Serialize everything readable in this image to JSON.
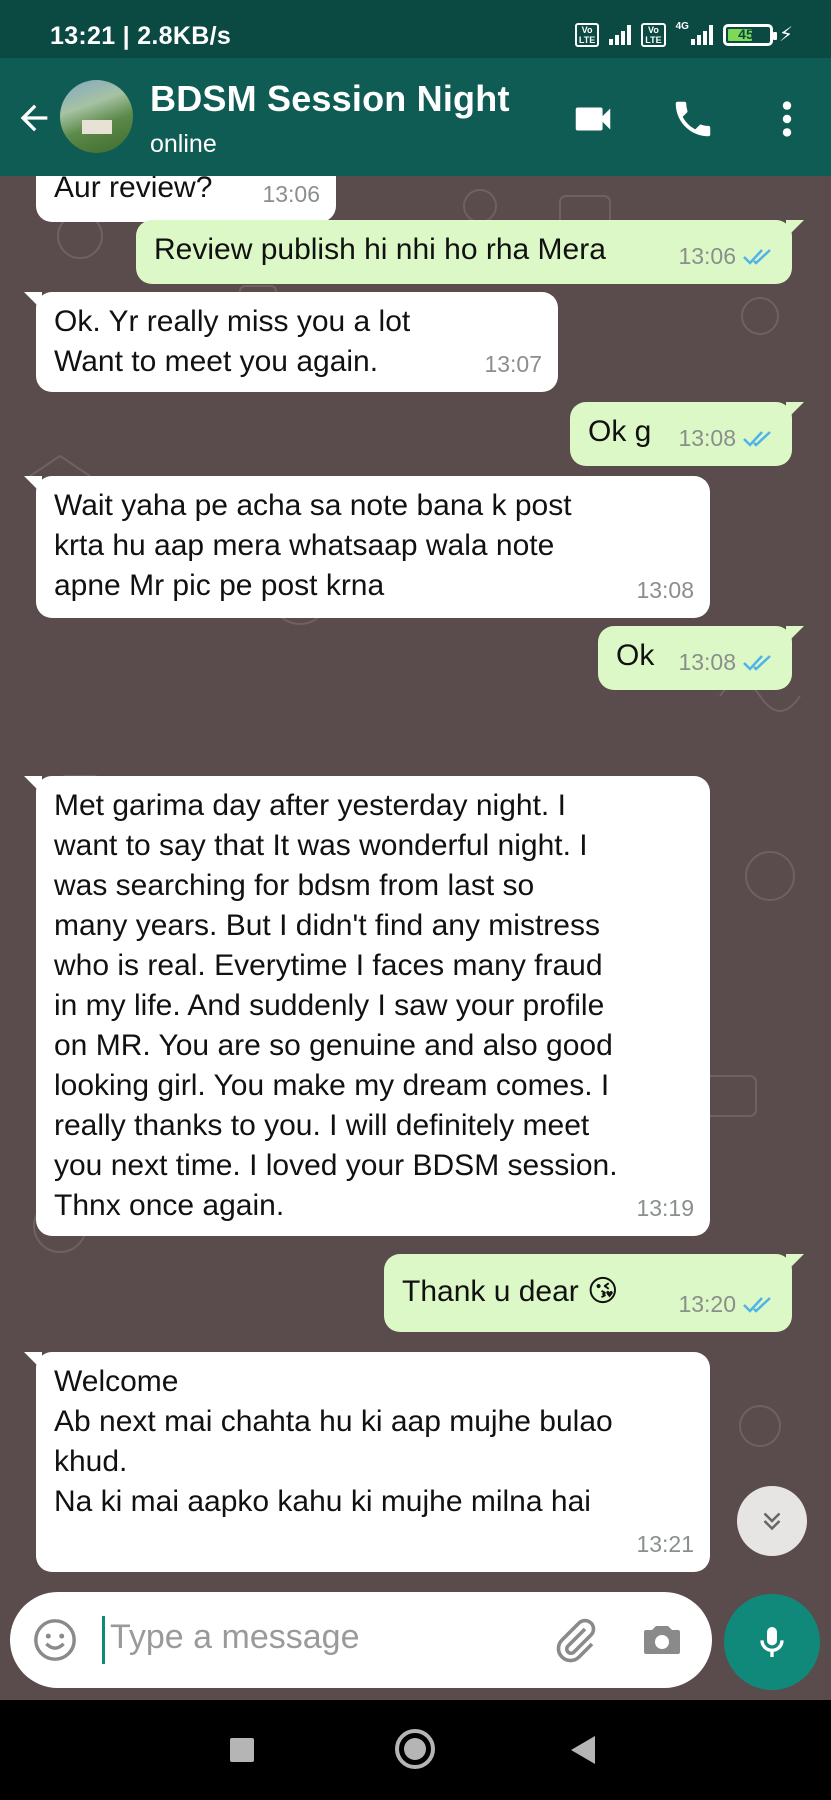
{
  "status_bar": {
    "time": "13:21 | 2.8KB/s",
    "lte_label": "Vo\nLTE",
    "network": "4G",
    "battery": "45"
  },
  "header": {
    "contact_name": "BDSM Session Night",
    "status": "online"
  },
  "messages": [
    {
      "dir": "in",
      "text": "Aur review?",
      "time": "13:06"
    },
    {
      "dir": "out",
      "text": "Review publish hi nhi ho rha Mera",
      "time": "13:06",
      "read": true
    },
    {
      "dir": "in",
      "text": "Ok. Yr really miss you a lot\nWant to meet you again.",
      "time": "13:07"
    },
    {
      "dir": "out",
      "text": "Ok g",
      "time": "13:08",
      "read": true
    },
    {
      "dir": "in",
      "text": "Wait yaha pe acha sa note bana k post\nkrta hu aap mera whatsaap wala note\napne Mr pic pe post krna",
      "time": "13:08"
    },
    {
      "dir": "out",
      "text": "Ok",
      "time": "13:08",
      "read": true
    },
    {
      "dir": "in",
      "text": "Met garima day after yesterday night. I\nwant to say that It was wonderful night. I\nwas searching for bdsm from last so\nmany years. But I didn't find any mistress\nwho is real. Everytime I faces many fraud\nin my life. And suddenly I saw your profile\non MR. You are so genuine and also good\nlooking girl. You make my dream comes. I\nreally thanks to you. I will definitely meet\nyou next time. I loved your BDSM session.\nThnx once again.",
      "time": "13:19"
    },
    {
      "dir": "out",
      "text": "Thank u dear 😘",
      "time": "13:20",
      "read": true
    },
    {
      "dir": "in",
      "text": "Welcome\nAb next mai chahta hu ki aap mujhe bulao\nkhud.\nNa ki mai aapko kahu ki mujhe milna hai",
      "time": "13:21"
    }
  ],
  "input": {
    "placeholder": "Type a message"
  },
  "colors": {
    "header": "#0f5c54",
    "status_bar": "#0b4a43",
    "outgoing": "#dcf8c6",
    "incoming": "#ffffff",
    "ticks": "#4fb3e8",
    "mic": "#11897a"
  }
}
